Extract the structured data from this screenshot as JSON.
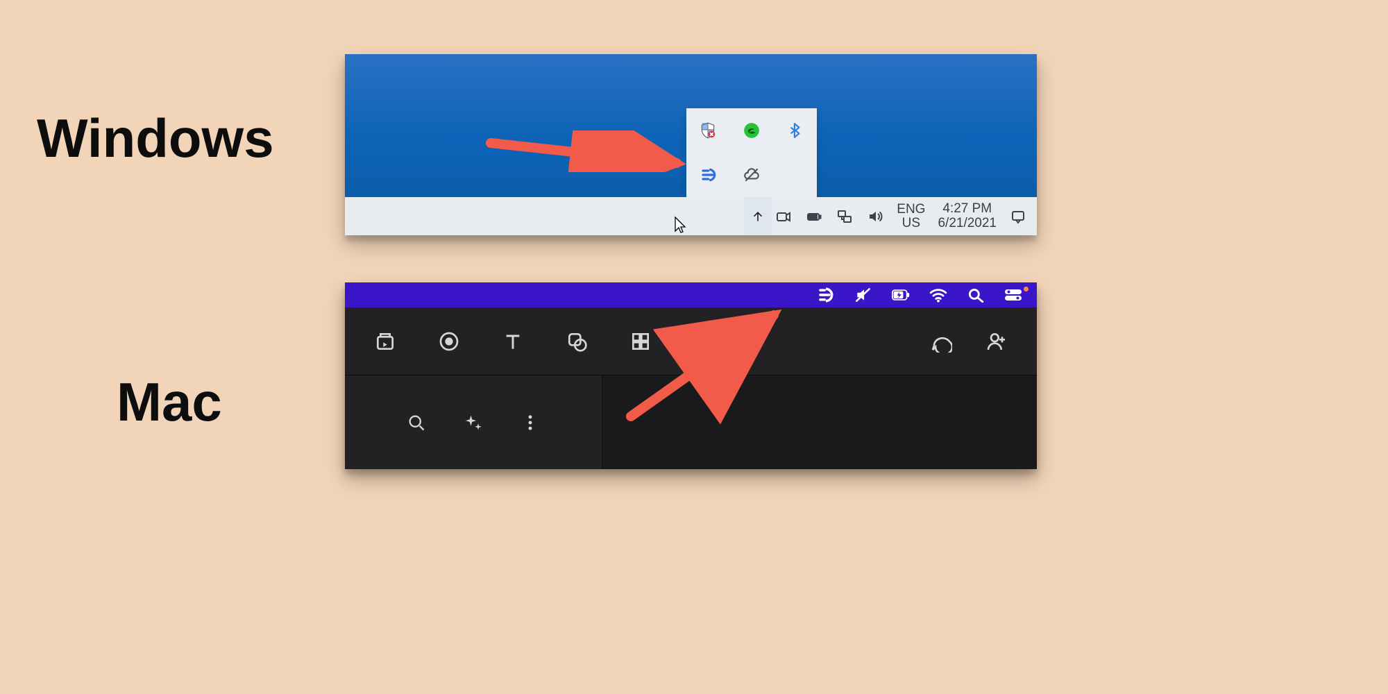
{
  "labels": {
    "windows": "Windows",
    "mac": "Mac"
  },
  "windows": {
    "taskbar": {
      "language_line1": "ENG",
      "language_line2": "US",
      "time": "4:27 PM",
      "date": "6/21/2021"
    },
    "tray_popup_icons": [
      "security-shield-icon",
      "razer-icon",
      "bluetooth-icon",
      "descript-icon",
      "cloud-disabled-icon"
    ],
    "taskbar_icons": [
      "overflow-chevron-up-icon",
      "camera-icon",
      "battery-icon",
      "network-icon",
      "volume-icon"
    ],
    "notification_icon": "notifications-icon"
  },
  "mac": {
    "menubar_icons": [
      "descript-icon",
      "volume-muted-icon",
      "battery-charging-icon",
      "wifi-icon",
      "spotlight-search-icon",
      "control-center-icon"
    ],
    "toolbar_left_icons": [
      "library-icon",
      "record-icon",
      "text-icon",
      "shapes-icon",
      "grid-icon"
    ],
    "toolbar_right_icons": [
      "comment-icon",
      "add-person-icon"
    ],
    "subbar_icons": [
      "search-icon",
      "sparkle-icon",
      "more-vertical-icon"
    ]
  }
}
